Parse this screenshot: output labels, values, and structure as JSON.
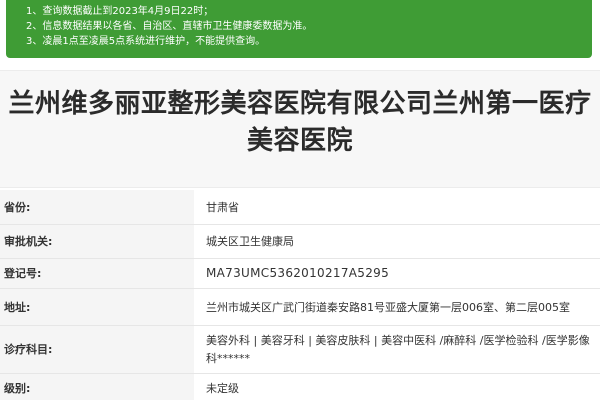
{
  "notice": {
    "lines": [
      "1、查询数据截止到2023年4月9日22时；",
      "2、信息数据结果以各省、自治区、直辖市卫生健康委数据为准。",
      "3、凌晨1点至凌晨5点系统进行维护，不能提供查询。"
    ],
    "background_color": "#3f9c35"
  },
  "title": "兰州维多丽亚整形美容医院有限公司兰州第一医疗美容医院",
  "fields": {
    "province": {
      "label": "省份:",
      "value": "甘肃省"
    },
    "authority": {
      "label": "审批机关:",
      "value": "城关区卫生健康局"
    },
    "registration": {
      "label": "登记号:",
      "value": "MA73UMC5362010217A5295"
    },
    "address": {
      "label": "地址:",
      "value": "兰州市城关区广武门街道秦安路81号亚盛大厦第一层006室、第二层005室"
    },
    "departments": {
      "label": "诊疗科目:",
      "value": "美容外科 | 美容牙科 | 美容皮肤科 | 美容中医科 /麻醉科 /医学检验科 /医学影像科******"
    },
    "level": {
      "label": "级别:",
      "value": "未定级"
    }
  }
}
